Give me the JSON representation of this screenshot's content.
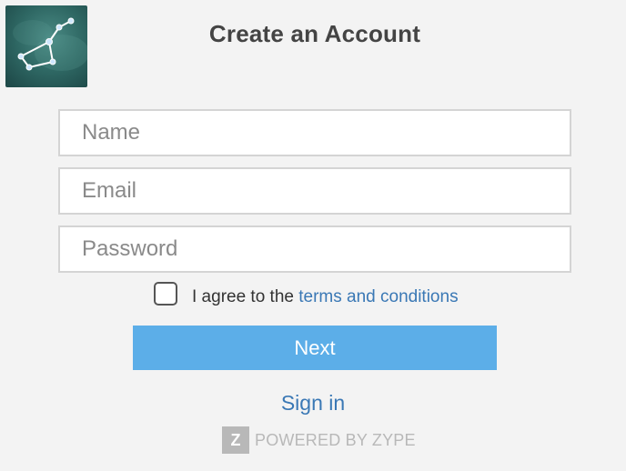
{
  "logo": {
    "icon": "constellation-logo-icon",
    "background_color": "#2f6e6a"
  },
  "header": {
    "title": "Create an Account"
  },
  "form": {
    "name_placeholder": "Name",
    "email_placeholder": "Email",
    "password_placeholder": "Password",
    "name_value": "",
    "email_value": "",
    "password_value": ""
  },
  "agreement": {
    "checked": false,
    "prefix": "I agree to the ",
    "link_text": "terms and conditions"
  },
  "next_button": {
    "label": "Next",
    "color": "#5caee8"
  },
  "sign_in": {
    "label": "Sign in"
  },
  "footer": {
    "badge_letter": "Z",
    "powered_text": "POWERED BY ZYPE"
  },
  "colors": {
    "link": "#3a78b5",
    "page_background": "#f3f3f3"
  }
}
